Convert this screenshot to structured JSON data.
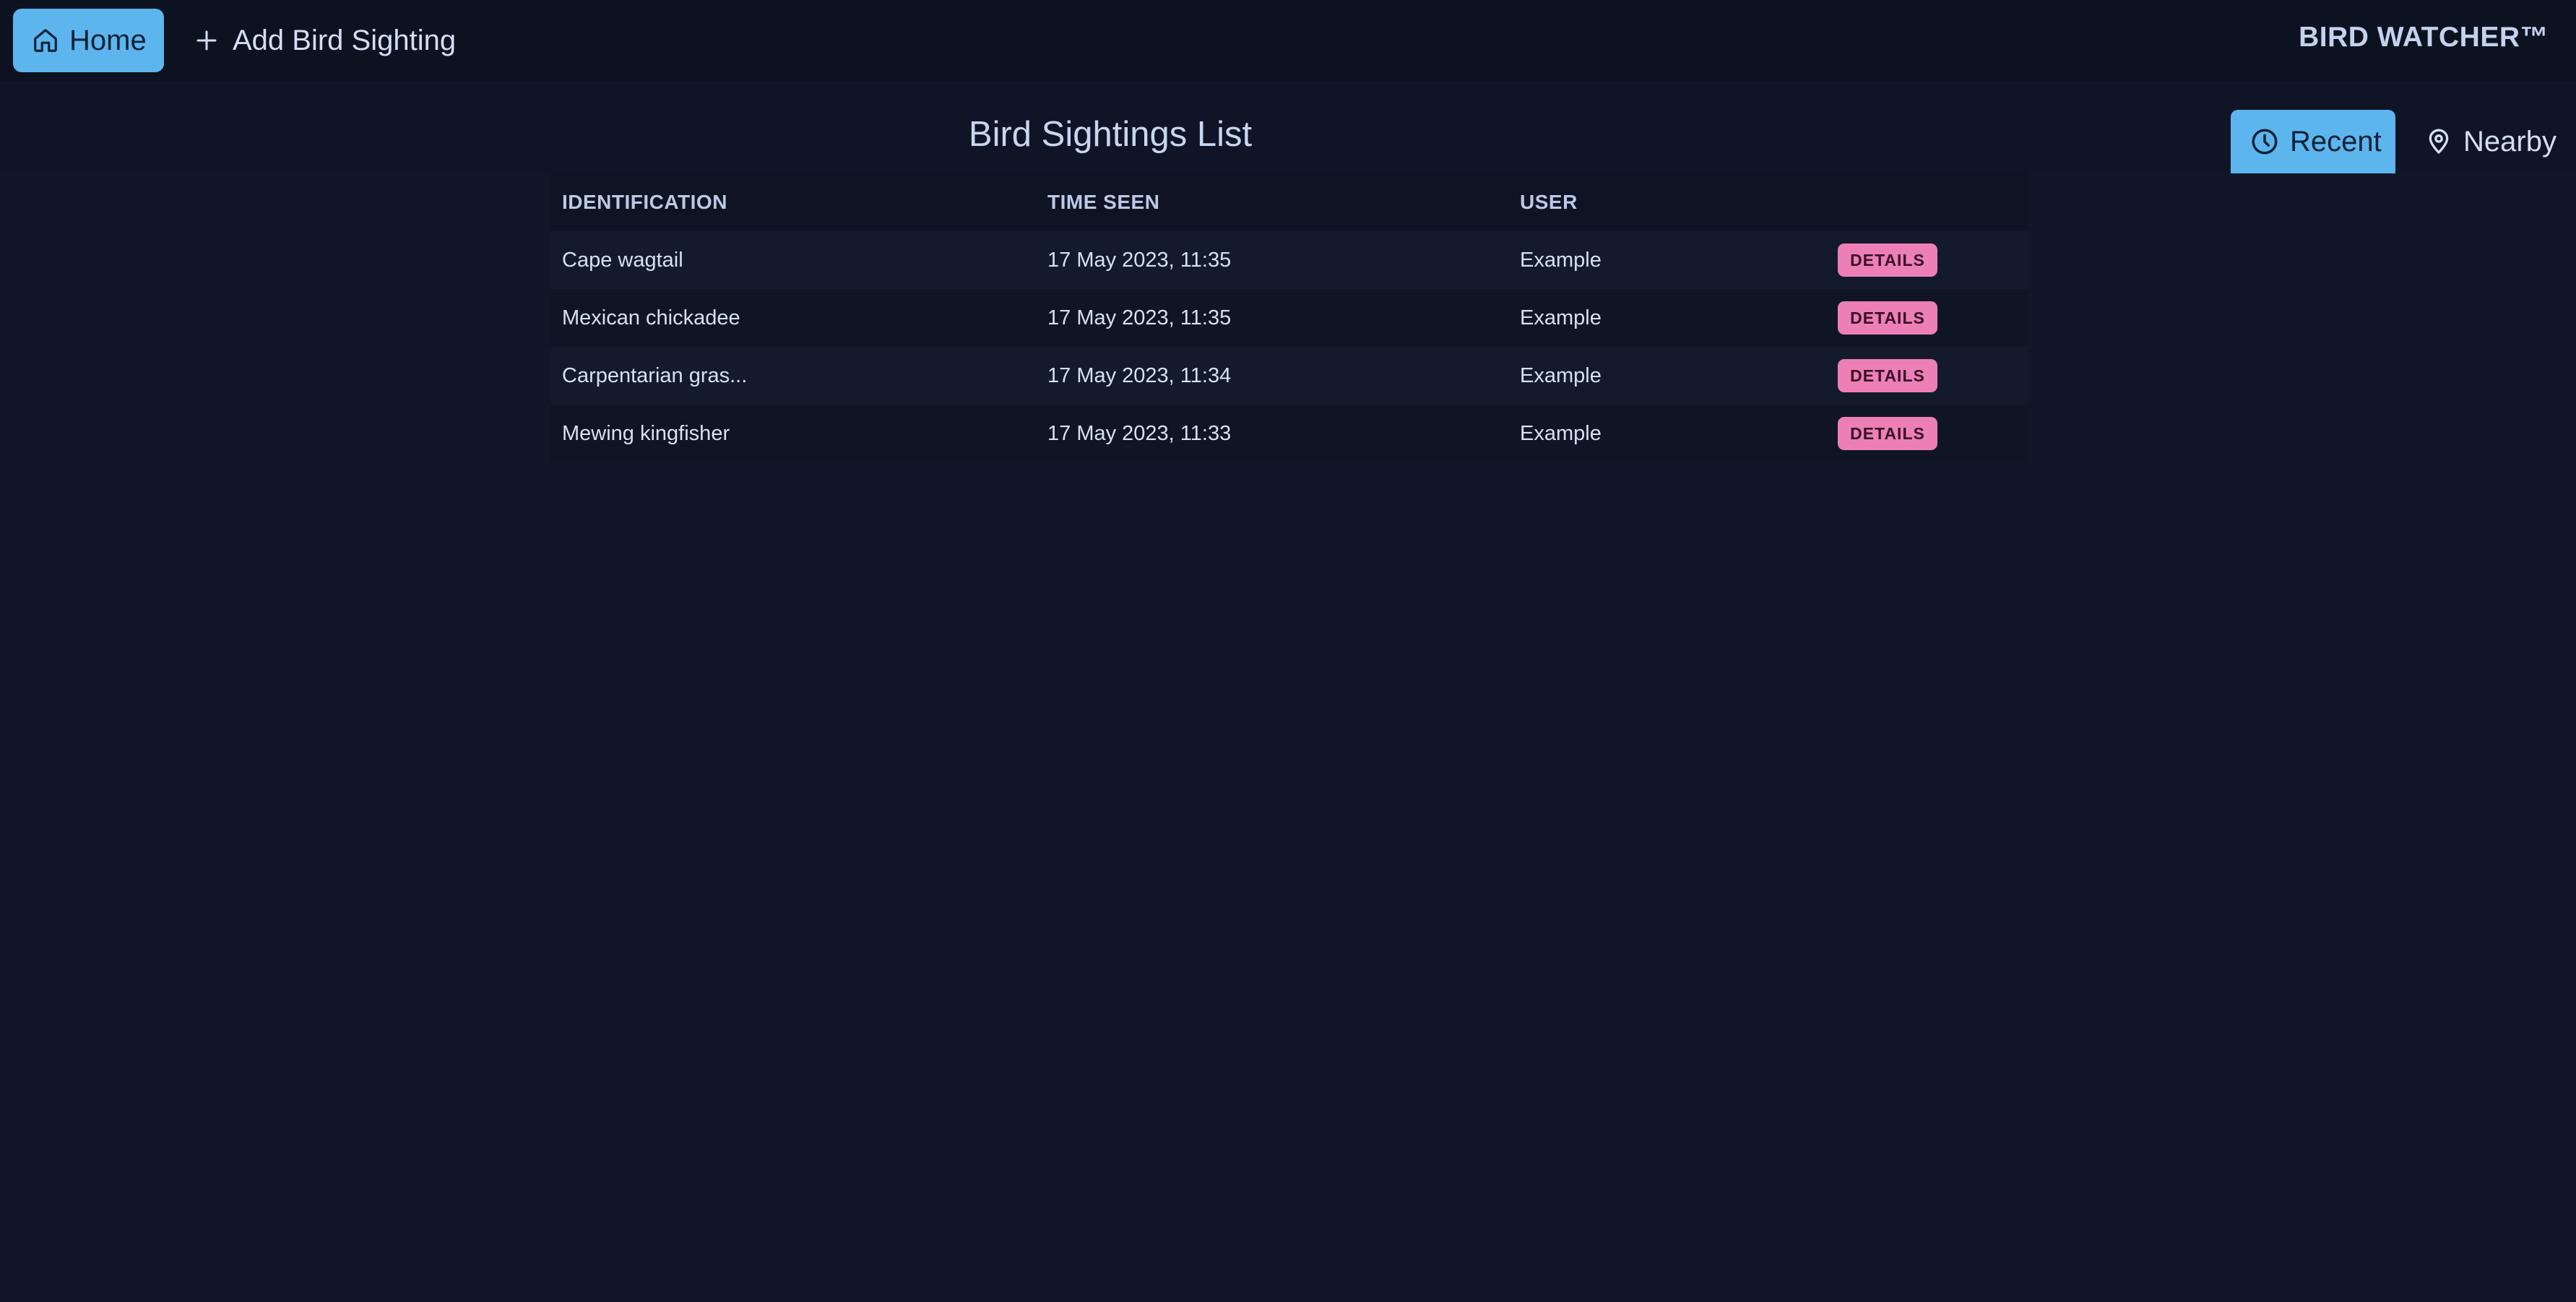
{
  "nav": {
    "home_label": "Home",
    "home_icon": "home-icon",
    "add_label": "Add Bird Sighting",
    "add_icon": "plus-icon",
    "brand": "BIRD WATCHER™"
  },
  "page": {
    "title": "Bird Sightings List"
  },
  "view_tabs": {
    "recent_label": "Recent",
    "recent_icon": "clock-icon",
    "nearby_label": "Nearby",
    "nearby_icon": "map-pin-icon",
    "active": "Recent"
  },
  "table": {
    "headers": [
      "IDENTIFICATION",
      "TIME SEEN",
      "USER"
    ],
    "rows": [
      {
        "identification": "Cape wagtail",
        "time_seen": "17 May 2023, 11:35",
        "user": "Example",
        "action": "DETAILS"
      },
      {
        "identification": "Mexican chickadee",
        "time_seen": "17 May 2023, 11:35",
        "user": "Example",
        "action": "DETAILS"
      },
      {
        "identification": "Carpentarian gras...",
        "time_seen": "17 May 2023, 11:34",
        "user": "Example",
        "action": "DETAILS"
      },
      {
        "identification": "Mewing kingfisher",
        "time_seen": "17 May 2023, 11:33",
        "user": "Example",
        "action": "DETAILS"
      }
    ]
  },
  "colors": {
    "background": "#111728",
    "topbar": "#0c1220",
    "accent": "#5db5ee",
    "details_button": "#ec80b6"
  }
}
